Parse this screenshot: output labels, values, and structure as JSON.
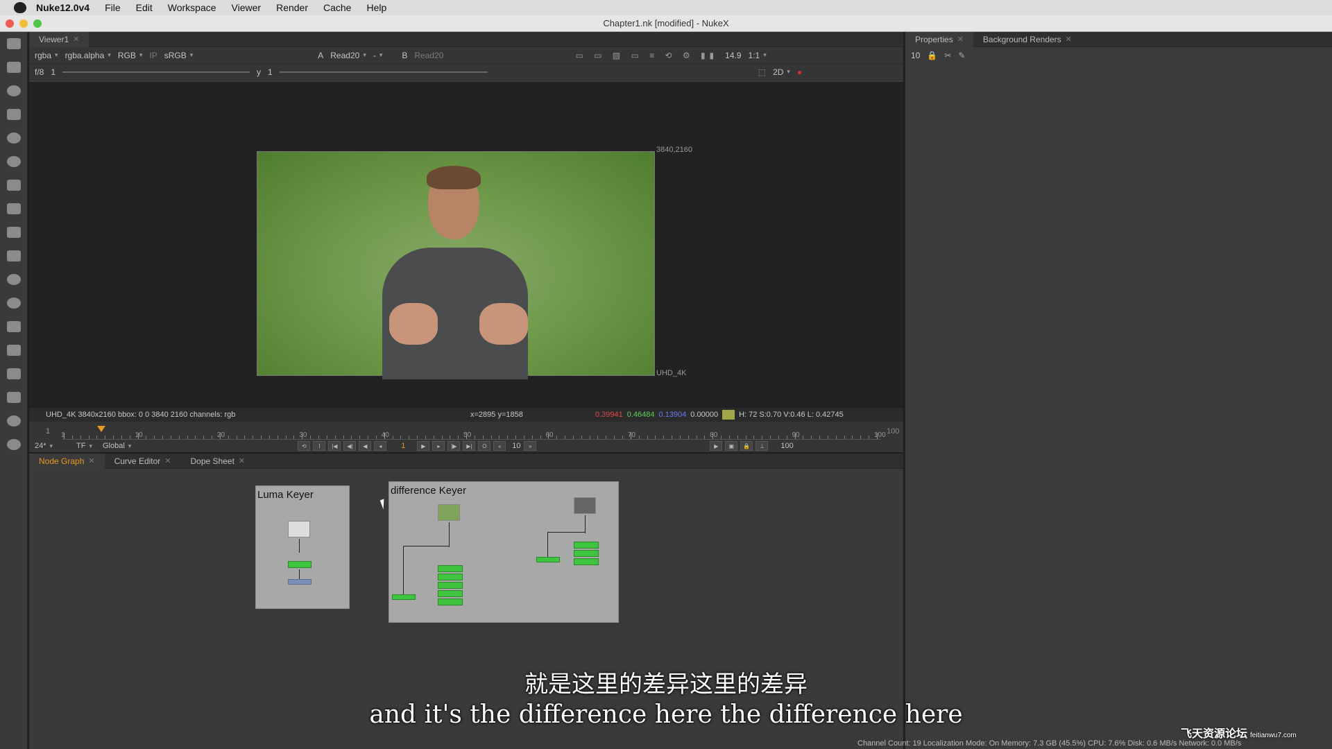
{
  "menubar": {
    "app": "Nuke12.0v4",
    "items": [
      "File",
      "Edit",
      "Workspace",
      "Viewer",
      "Render",
      "Cache",
      "Help"
    ]
  },
  "window": {
    "title": "Chapter1.nk [modified] - NukeX"
  },
  "viewer": {
    "tab": "Viewer1",
    "channels": "rgba",
    "alpha": "rgba.alpha",
    "mode": "RGB",
    "ip": "IP",
    "lut": "sRGB",
    "a_label": "A",
    "a_input": "Read20",
    "b_input_sep": "-",
    "b_label": "B",
    "b_input": "Read20",
    "fstop": "f/8",
    "fstop_val": "1",
    "y_label": "y",
    "y_val": "1",
    "gain": "14.9",
    "zoom": "1:1",
    "view_mode": "2D",
    "format_top": "3840,2160",
    "format_bottom": "UHD_4K",
    "info": "UHD_4K 3840x2160  bbox: 0 0 3840 2160 channels: rgb",
    "coords": "x=2895 y=1858",
    "px_r": "0.39941",
    "px_g": "0.46484",
    "px_b": "0.13904",
    "px_a": "0.00000",
    "hsvl": "H: 72 S:0.70 V:0.46  L: 0.42745"
  },
  "timeline": {
    "start": "1",
    "end": "100",
    "ticks": [
      "1",
      "10",
      "20",
      "30",
      "40",
      "50",
      "60",
      "70",
      "80",
      "90",
      "100"
    ],
    "fps": "24*",
    "tf": "TF",
    "scope": "Global",
    "frame": "1",
    "step": "10",
    "out": "100"
  },
  "properties": {
    "tab1": "Properties",
    "tab2": "Background Renders",
    "max_panels": "10"
  },
  "bottom_tabs": [
    "Node Graph",
    "Curve Editor",
    "Dope Sheet"
  ],
  "nodegraph": {
    "backdrop1": "Luma Keyer",
    "backdrop2": "difference Keyer"
  },
  "subtitles": {
    "zh": "就是这里的差异这里的差异",
    "en": "and it's the difference here the difference here"
  },
  "status": "Channel Count: 19  Localization Mode: On  Memory: 7.3 GB (45.5%)  CPU: 7.6%  Disk: 0.6 MB/s  Network: 0.0 MB/s",
  "watermark": {
    "main": "飞天资源论坛",
    "url": "feitianwu7.com"
  },
  "colors": {
    "accent": "#e69a22",
    "node_green": "#3ec43e",
    "r": "#e04848",
    "g": "#5ad05a",
    "b": "#6a7af0"
  }
}
